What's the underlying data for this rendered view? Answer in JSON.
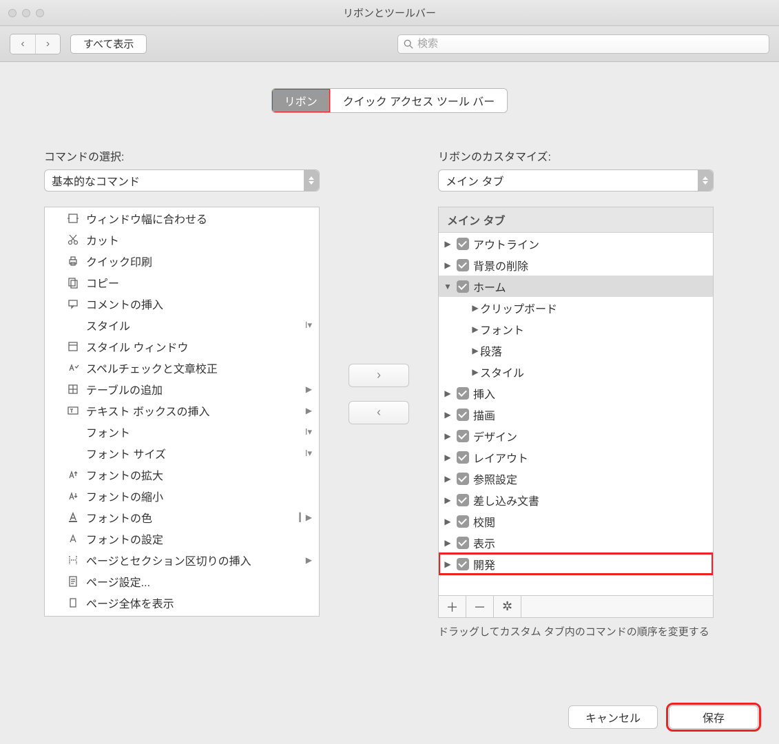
{
  "window": {
    "title": "リボンとツールバー"
  },
  "toolbar": {
    "show_all": "すべて表示",
    "search_placeholder": "検索"
  },
  "tabs": [
    {
      "label": "リボン",
      "active": true,
      "highlight": true
    },
    {
      "label": "クイック アクセス ツール バー",
      "active": false,
      "highlight": false
    }
  ],
  "left": {
    "label": "コマンドの選択:",
    "select": "基本的なコマンド",
    "items": [
      {
        "icon": "fit-width",
        "label": "ウィンドウ幅に合わせる"
      },
      {
        "icon": "cut",
        "label": "カット"
      },
      {
        "icon": "quick-print",
        "label": "クイック印刷"
      },
      {
        "icon": "copy",
        "label": "コピー"
      },
      {
        "icon": "comment",
        "label": "コメントの挿入"
      },
      {
        "icon": "",
        "label": "スタイル",
        "trail": "dd"
      },
      {
        "icon": "style-window",
        "label": "スタイル ウィンドウ"
      },
      {
        "icon": "spell",
        "label": "スペルチェックと文章校正"
      },
      {
        "icon": "table",
        "label": "テーブルの追加",
        "trail": "arrow"
      },
      {
        "icon": "textbox",
        "label": "テキスト ボックスの挿入",
        "trail": "arrow"
      },
      {
        "icon": "",
        "label": "フォント",
        "trail": "dd"
      },
      {
        "icon": "",
        "label": "フォント サイズ",
        "trail": "dd"
      },
      {
        "icon": "font-grow",
        "label": "フォントの拡大"
      },
      {
        "icon": "font-shrink",
        "label": "フォントの縮小"
      },
      {
        "icon": "font-color",
        "label": "フォントの色",
        "trail": "split"
      },
      {
        "icon": "font-settings",
        "label": "フォントの設定"
      },
      {
        "icon": "page-break",
        "label": "ページとセクション区切りの挿入",
        "trail": "arrow"
      },
      {
        "icon": "page-setup",
        "label": "ページ設定..."
      },
      {
        "icon": "show-page",
        "label": "ページ全体を表示"
      }
    ]
  },
  "right": {
    "label": "リボンのカスタマイズ:",
    "select": "メイン タブ",
    "header": "メイン タブ",
    "tree": [
      {
        "label": "アウトライン",
        "check": true,
        "disc": "right"
      },
      {
        "label": "背景の削除",
        "check": true,
        "disc": "right"
      },
      {
        "label": "ホーム",
        "check": true,
        "disc": "down",
        "selected": true,
        "children": [
          {
            "label": "クリップボード"
          },
          {
            "label": "フォント"
          },
          {
            "label": "段落"
          },
          {
            "label": "スタイル"
          }
        ]
      },
      {
        "label": "挿入",
        "check": true,
        "disc": "right"
      },
      {
        "label": "描画",
        "check": true,
        "disc": "right"
      },
      {
        "label": "デザイン",
        "check": true,
        "disc": "right"
      },
      {
        "label": "レイアウト",
        "check": true,
        "disc": "right"
      },
      {
        "label": "参照設定",
        "check": true,
        "disc": "right"
      },
      {
        "label": "差し込み文書",
        "check": true,
        "disc": "right"
      },
      {
        "label": "校閲",
        "check": true,
        "disc": "right"
      },
      {
        "label": "表示",
        "check": true,
        "disc": "right"
      },
      {
        "label": "開発",
        "check": true,
        "disc": "right",
        "highlight": true
      }
    ],
    "hint": "ドラッグしてカスタム タブ内のコマンドの順序を変更する"
  },
  "buttons": {
    "cancel": "キャンセル",
    "save": "保存"
  }
}
